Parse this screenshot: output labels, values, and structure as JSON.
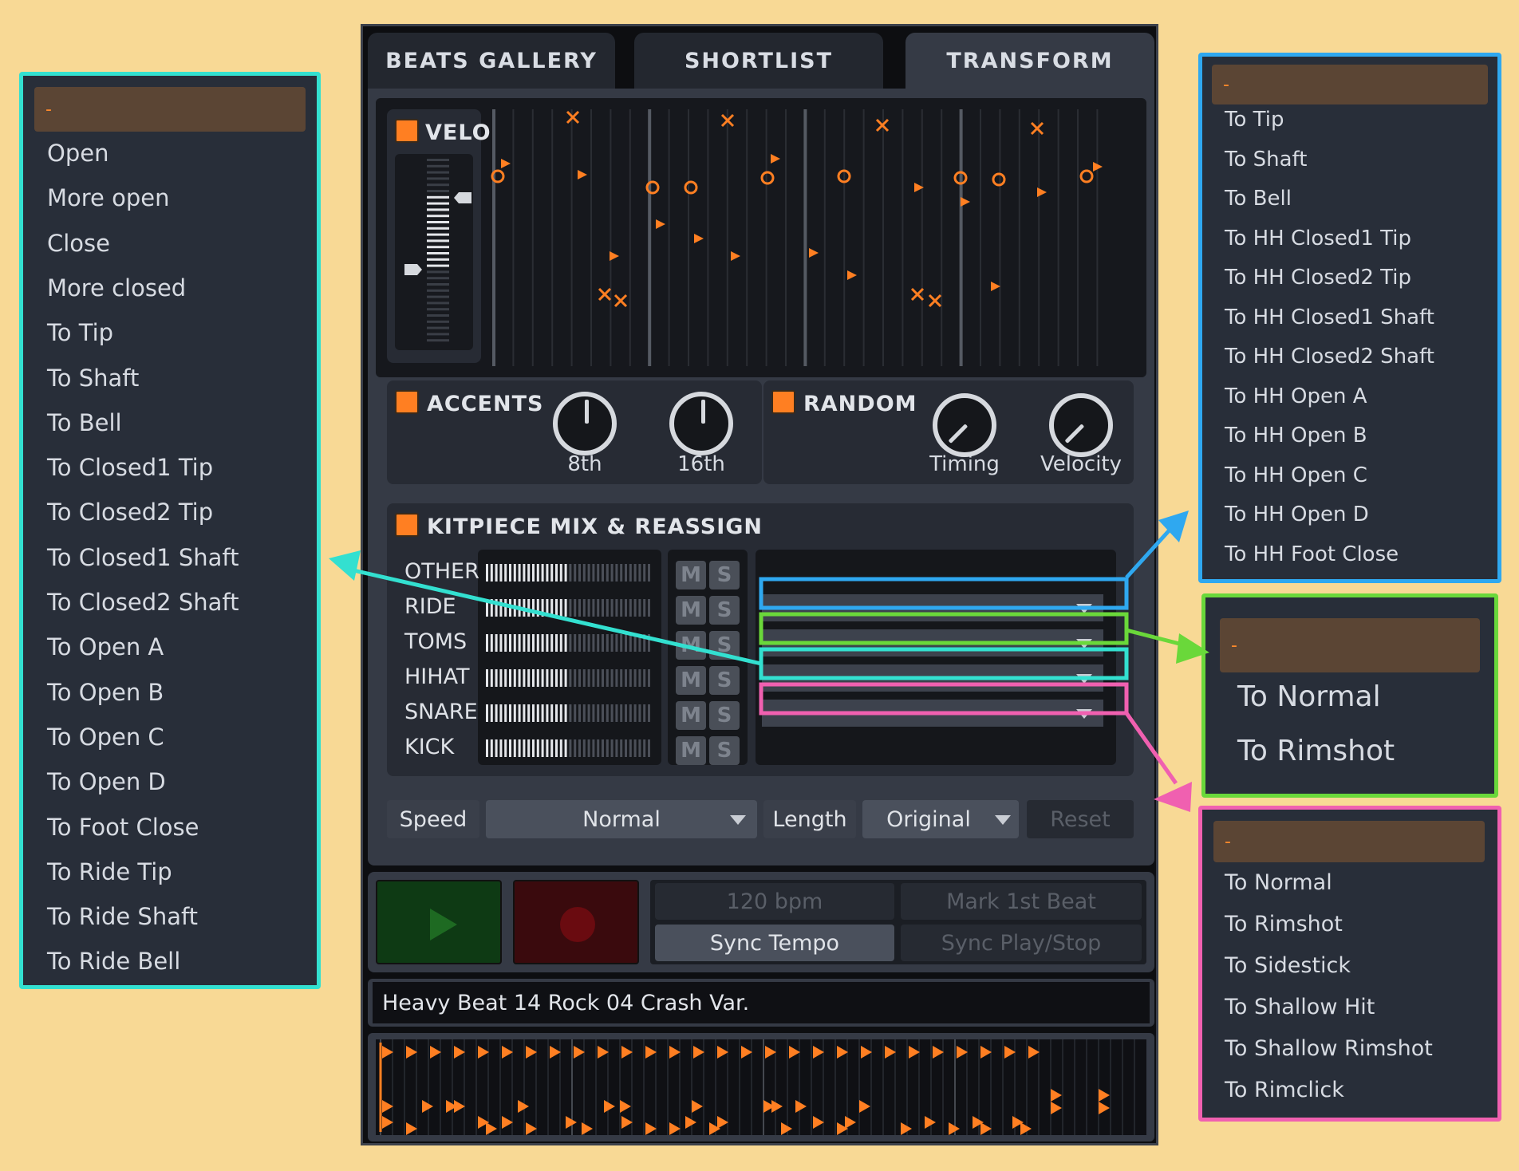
{
  "tabs": [
    "BEATS GALLERY",
    "SHORTLIST",
    "TRANSFORM"
  ],
  "velo": {
    "title": "VELO"
  },
  "accents": {
    "title": "ACCENTS",
    "knobs": [
      "8th",
      "16th"
    ]
  },
  "random": {
    "title": "RANDOM",
    "knobs": [
      "Timing",
      "Velocity"
    ]
  },
  "kitpiece": {
    "title": "KITPIECE MIX & REASSIGN",
    "rows": [
      "OTHER",
      "RIDE",
      "TOMS",
      "HIHAT",
      "SNARE",
      "KICK"
    ],
    "mute_label": "M",
    "solo_label": "S",
    "selects": [
      "-",
      "-",
      "-",
      "-"
    ]
  },
  "speed": {
    "label": "Speed",
    "value": "Normal"
  },
  "length": {
    "label": "Length",
    "value": "Original"
  },
  "reset_label": "Reset",
  "transport": {
    "bpm": "120 bpm",
    "mark_first_beat": "Mark 1st Beat",
    "sync_tempo": "Sync Tempo",
    "sync_play_stop": "Sync Play/Stop"
  },
  "beat_name": "Heavy Beat 14 Rock 04 Crash Var.",
  "hihat_menu": {
    "selected": "-",
    "items": [
      "Open",
      "More open",
      "Close",
      "More closed",
      "To Tip",
      "To Shaft",
      "To Bell",
      "To Closed1 Tip",
      "To Closed2 Tip",
      "To Closed1 Shaft",
      "To Closed2 Shaft",
      "To Open A",
      "To Open B",
      "To Open C",
      "To Open D",
      "To Foot Close",
      "To Ride Tip",
      "To Ride Shaft",
      "To Ride Bell"
    ]
  },
  "ride_menu": {
    "selected": "-",
    "items": [
      "To Tip",
      "To Shaft",
      "To Bell",
      "To HH Closed1 Tip",
      "To HH Closed2 Tip",
      "To HH Closed1 Shaft",
      "To HH Closed2 Shaft",
      "To HH Open A",
      "To HH Open B",
      "To HH Open C",
      "To HH Open D",
      "To HH Foot Close"
    ]
  },
  "toms_menu": {
    "selected": "-",
    "items": [
      "To Normal",
      "To Rimshot"
    ]
  },
  "snare_menu": {
    "selected": "-",
    "items": [
      "To Normal",
      "To Rimshot",
      "To Sidestick",
      "To Shallow Hit",
      "To Shallow Rimshot",
      "To Rimclick"
    ]
  },
  "colors": {
    "accent": "#ff7f22",
    "hihat_outline": "#33e0d0",
    "ride_outline": "#2fa8f0",
    "toms_outline": "#6ad83a",
    "snare_outline": "#f060b0",
    "play_button": "#0e3a14",
    "record_button": "#3a0a0d"
  },
  "icons": [
    "play-icon",
    "record-icon",
    "caret-down-icon"
  ]
}
